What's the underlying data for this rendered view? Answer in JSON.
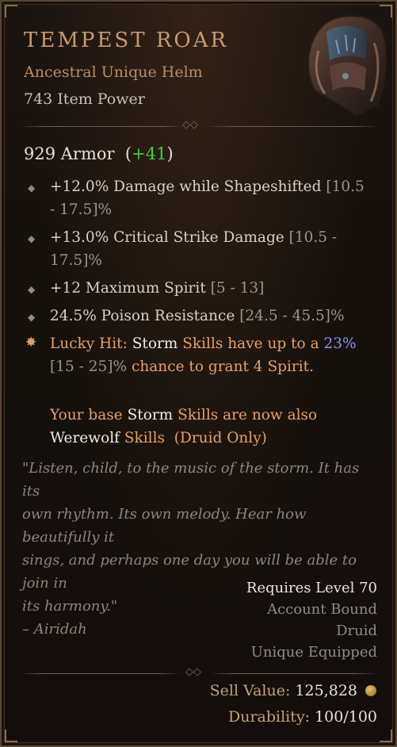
{
  "item": {
    "name": "Tempest Roar",
    "type": "Ancestral Unique Helm",
    "item_power": "743 Item Power",
    "icon": "helm-icon"
  },
  "armor": {
    "value": "929 Armor",
    "bonus_open": "(",
    "bonus": "+41",
    "bonus_close": ")"
  },
  "affixes": [
    {
      "text": "+12.0% Damage while Shapeshifted ",
      "range": "[10.5",
      "line2": "- 17.5]%"
    },
    {
      "text": "+13.0% Critical Strike Damage ",
      "range": "[10.5 -",
      "line2": "17.5]%"
    },
    {
      "text": "+12 Maximum Spirit ",
      "range": "[5 - 13]"
    },
    {
      "text": "24.5% Poison Resistance ",
      "range": "[24.5 - 45.5]%"
    }
  ],
  "unique": {
    "lucky_hit_label": "Lucky Hit:",
    "storm": "Storm",
    "text1": "Skills have up to a",
    "value": "23%",
    "range": "[15 - 25]%",
    "text2": "chance to grant 4 Spirit.",
    "p2_text1": "Your base",
    "p2_storm": "Storm",
    "p2_text2": "Skills are now also",
    "werewolf": "Werewolf",
    "skills": "Skills",
    "druid_only": "(Druid Only)"
  },
  "flavor": {
    "lines": [
      "\"Listen, child, to the music of the storm. It has its",
      "own rhythm. Its own melody. Hear how beautifully it",
      "sings, and perhaps one day you will be able to join in",
      "its harmony.\"",
      "– Airidah"
    ]
  },
  "requirements": {
    "level": "Requires Level 70",
    "bound": "Account Bound",
    "class": "Druid",
    "unique_equipped": "Unique Equipped"
  },
  "footer": {
    "sell_label": "Sell Value:",
    "sell_value": "125,828",
    "durability_label": "Durability:",
    "durability_value": "100/100"
  },
  "colors": {
    "unique_name": "#c89a72",
    "bonus_green": "#3fcf3f",
    "skill_orange": "#e5a06a",
    "value_purple": "#8f8ff2"
  }
}
